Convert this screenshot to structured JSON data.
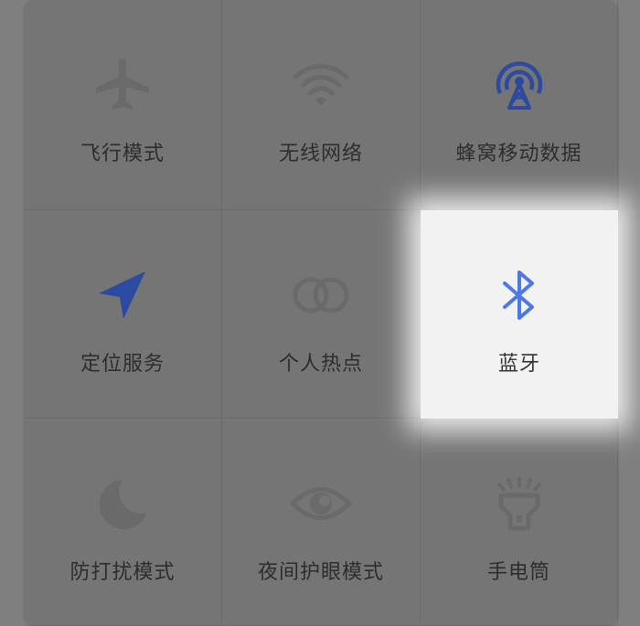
{
  "colors": {
    "inactive_icon": "#696969",
    "active_icon_blue": "#2c4aa0",
    "bluetooth_blue": "#4c79e6",
    "highlight_bg": "#f2f2f2"
  },
  "tiles": [
    {
      "label": "飞行模式",
      "icon": "airplane-icon",
      "active": false
    },
    {
      "label": "无线网络",
      "icon": "wifi-icon",
      "active": false
    },
    {
      "label": "蜂窝移动数据",
      "icon": "cellular-tower-icon",
      "active": true
    },
    {
      "label": "定位服务",
      "icon": "location-arrow-icon",
      "active": true
    },
    {
      "label": "个人热点",
      "icon": "hotspot-link-icon",
      "active": false
    },
    {
      "label": "蓝牙",
      "icon": "bluetooth-icon",
      "active": true,
      "highlighted": true
    },
    {
      "label": "防打扰模式",
      "icon": "moon-icon",
      "active": false
    },
    {
      "label": "夜间护眼模式",
      "icon": "eye-icon",
      "active": false
    },
    {
      "label": "手电筒",
      "icon": "flashlight-icon",
      "active": false
    }
  ]
}
